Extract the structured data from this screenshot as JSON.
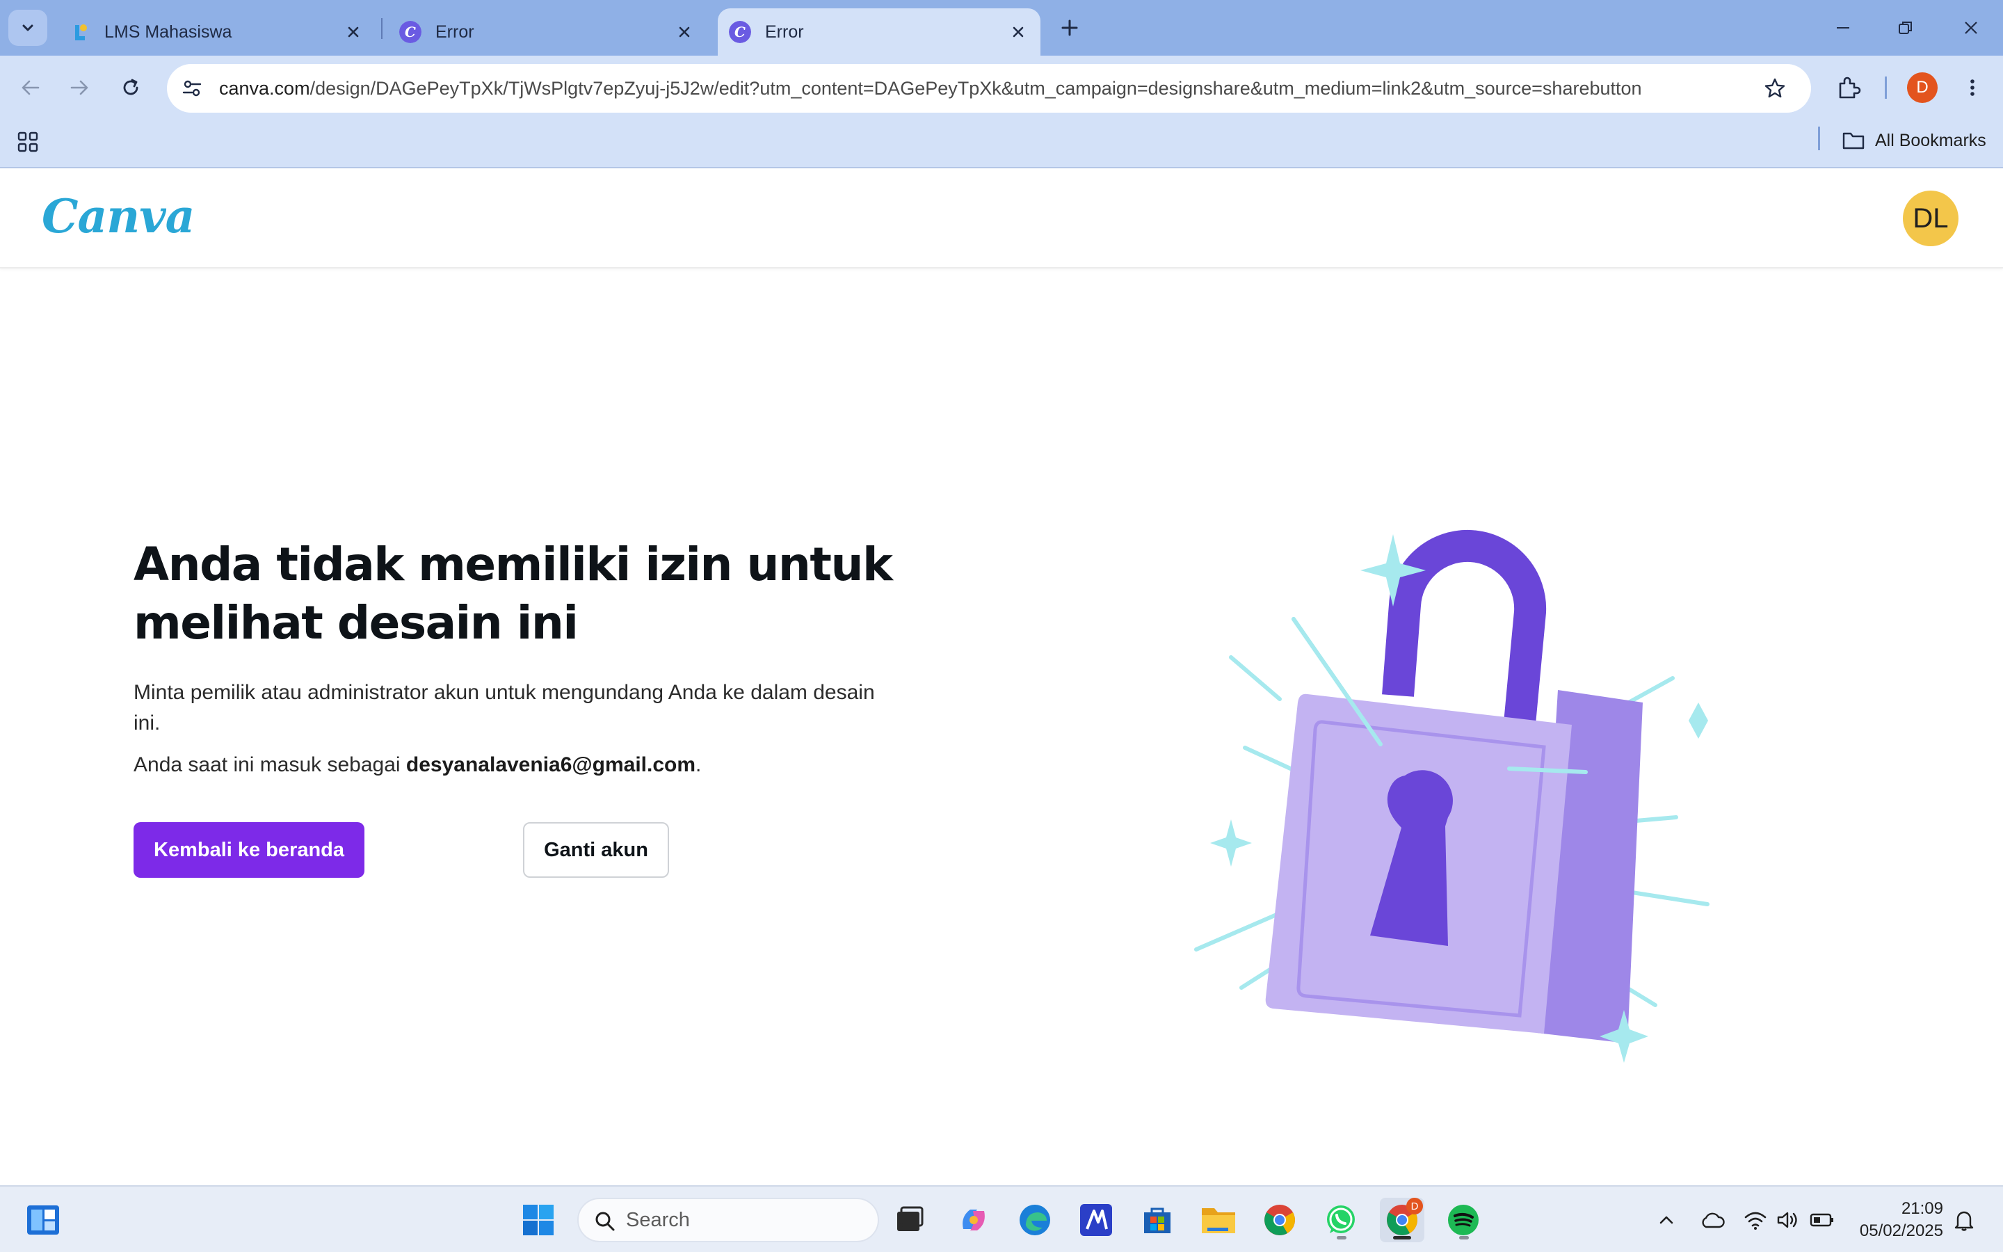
{
  "browser": {
    "tabs": [
      {
        "title": "LMS Mahasiswa",
        "active": false
      },
      {
        "title": "Error",
        "active": false
      },
      {
        "title": "Error",
        "active": true
      }
    ],
    "url_host": "canva.com",
    "url_path": "/design/DAGePeyTpXk/TjWsPlgtv7epZyuj-j5J2w/edit?utm_content=DAGePeyTpXk&utm_campaign=designshare&utm_medium=link2&utm_source=sharebutton",
    "profile_initial": "D",
    "bookmarks_label": "All Bookmarks"
  },
  "page": {
    "logo_text": "Canva",
    "avatar_initials": "DL",
    "headline": "Anda tidak memiliki izin untuk melihat desain ini",
    "description": "Minta pemilik atau administrator akun untuk mengundang Anda ke dalam desain ini.",
    "signed_in_prefix": "Anda saat ini masuk sebagai ",
    "signed_in_email": "desyanalavenia6@gmail.com",
    "signed_in_suffix": ".",
    "primary_button": "Kembali ke beranda",
    "secondary_button": "Ganti akun"
  },
  "taskbar": {
    "search_placeholder": "Search",
    "chrome_badge": "D",
    "time": "21:09",
    "date": "05/02/2025"
  },
  "colors": {
    "accent": "#7d2ae8",
    "tabstrip": "#8fb0e6",
    "toolbar": "#d3e1f8",
    "avatar": "#f3c64a"
  }
}
